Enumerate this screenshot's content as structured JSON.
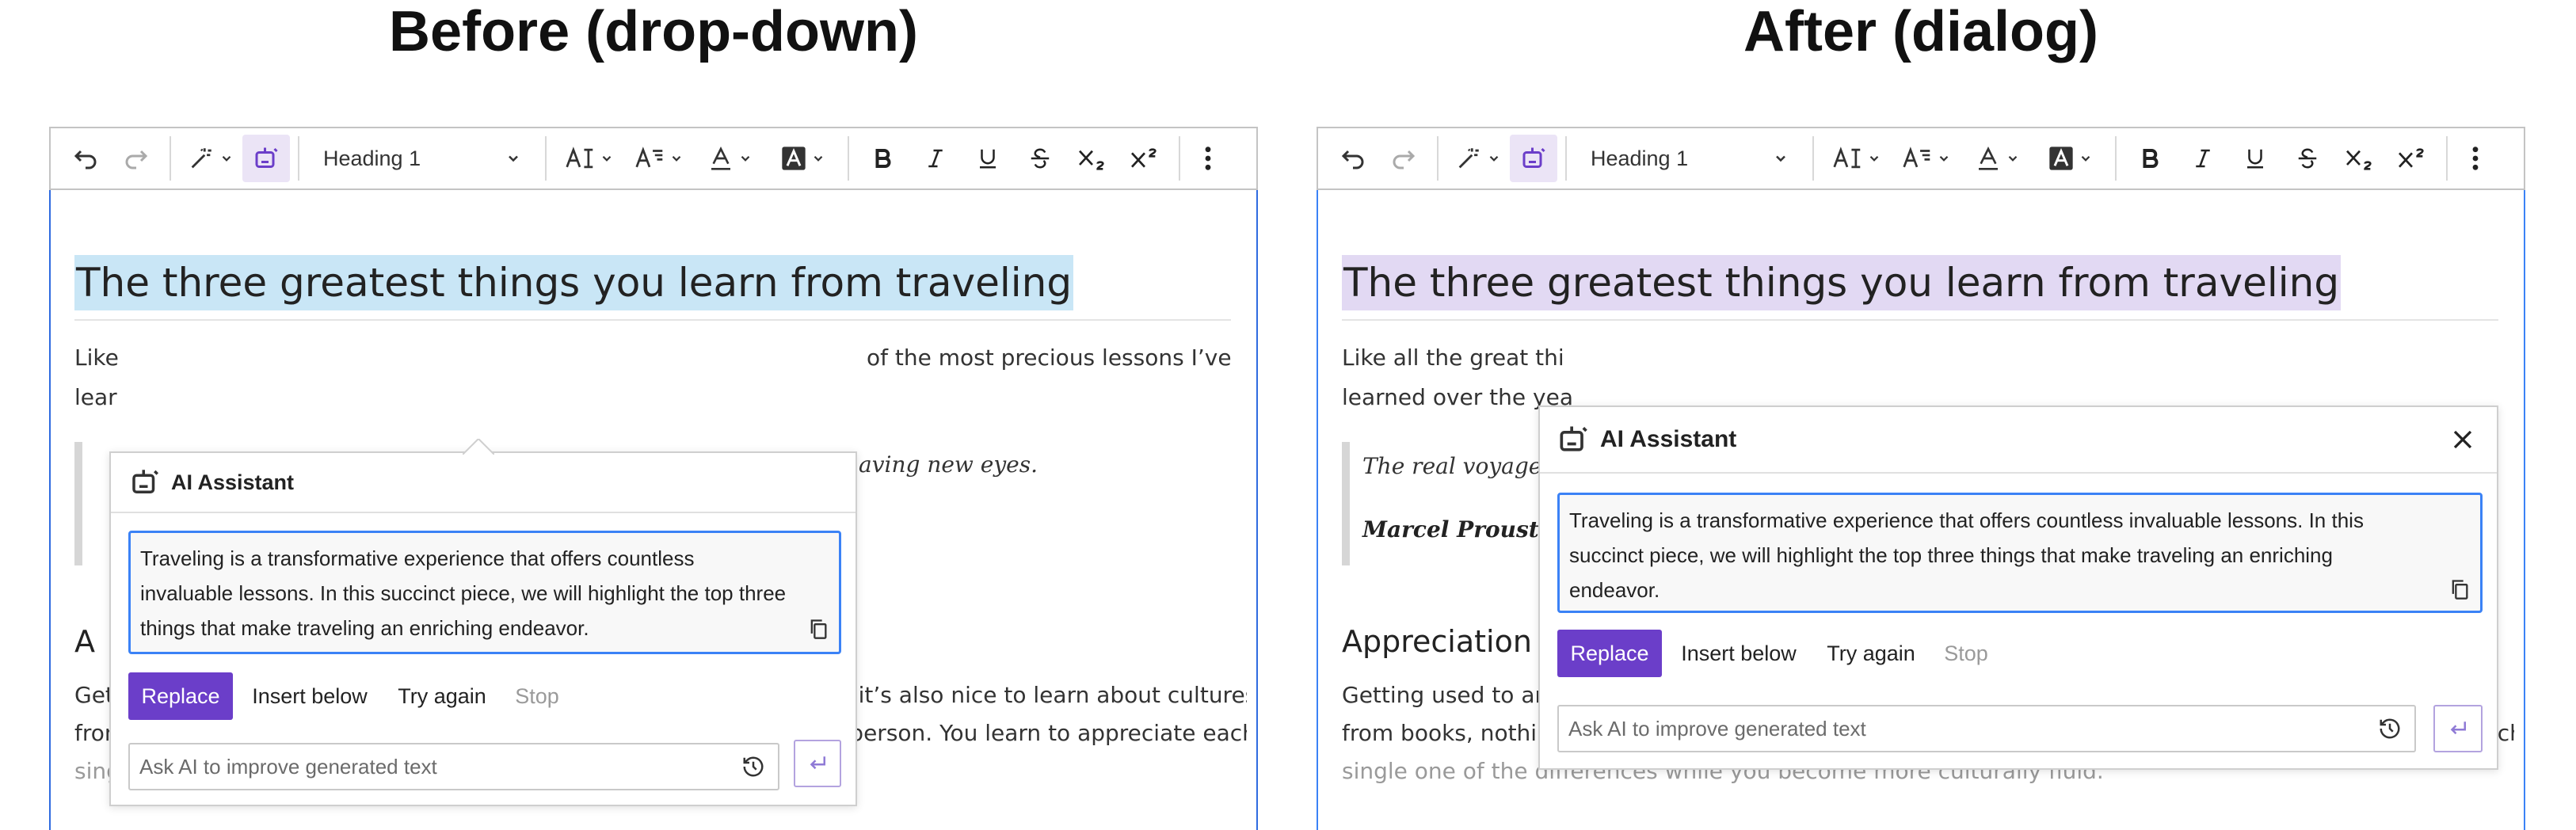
{
  "titles": {
    "before": "Before (drop-down)",
    "after": "After (dialog)"
  },
  "toolbar": {
    "heading_select": "Heading 1",
    "icons": [
      "undo-icon",
      "redo-icon",
      "ai-commands-icon",
      "ai-assistant-icon",
      "font-size-icon",
      "font-family-icon",
      "font-color-icon",
      "font-background-icon",
      "bold-icon",
      "italic-icon",
      "underline-icon",
      "strikethrough-icon",
      "subscript-icon",
      "superscript-icon",
      "more-icon"
    ]
  },
  "document": {
    "heading": "The three greatest things you learn from traveling",
    "para1_before_left": "Like",
    "para1_before_left2": "lear",
    "para1_before_right": "of the most precious lessons I’ve",
    "para1_after_line1": "Like all the great thi",
    "para1_after_line2": "learned over the yea",
    "quote_before_right": "aving new eyes.",
    "quote_after": "The real voyage",
    "quote_author": "Marcel Proust",
    "h2_before": "A",
    "h2_after": "Appreciation of",
    "para2_before_l1": "Getting used to an entirely different culture can be challenging. While it’s also nice to learn about cultures online or",
    "para2_l2": "from books, nothing comes close to experiencing cultural diversity in person. You learn to appreciate each and every",
    "para2_l3": "single one of the differences while you become more culturally fluid.",
    "para2_after_l1": "Getting used to an en"
  },
  "ai_before": {
    "title": "AI Assistant",
    "output_lines": [
      "Traveling is a transformative experience that offers countless",
      "invaluable lessons. In this succinct piece, we will highlight the top three",
      "things that make traveling an enriching endeavor."
    ],
    "replace": "Replace",
    "insert_below": "Insert below",
    "try_again": "Try again",
    "stop": "Stop",
    "prompt_placeholder": "Ask AI to improve generated text"
  },
  "ai_after": {
    "title": "AI Assistant",
    "output_lines": [
      "Traveling is a transformative experience that offers countless invaluable lessons. In this",
      "succinct piece, we will highlight the top three things that make traveling an enriching",
      "endeavor."
    ],
    "replace": "Replace",
    "insert_below": "Insert below",
    "try_again": "Try again",
    "stop": "Stop",
    "prompt_placeholder": "Ask AI to improve generated text"
  },
  "colors": {
    "accent_purple": "#6b3ec9",
    "focus_blue": "#3b82f6",
    "highlight_blue": "#c9e6f6",
    "highlight_purple": "#e2d9f3"
  }
}
